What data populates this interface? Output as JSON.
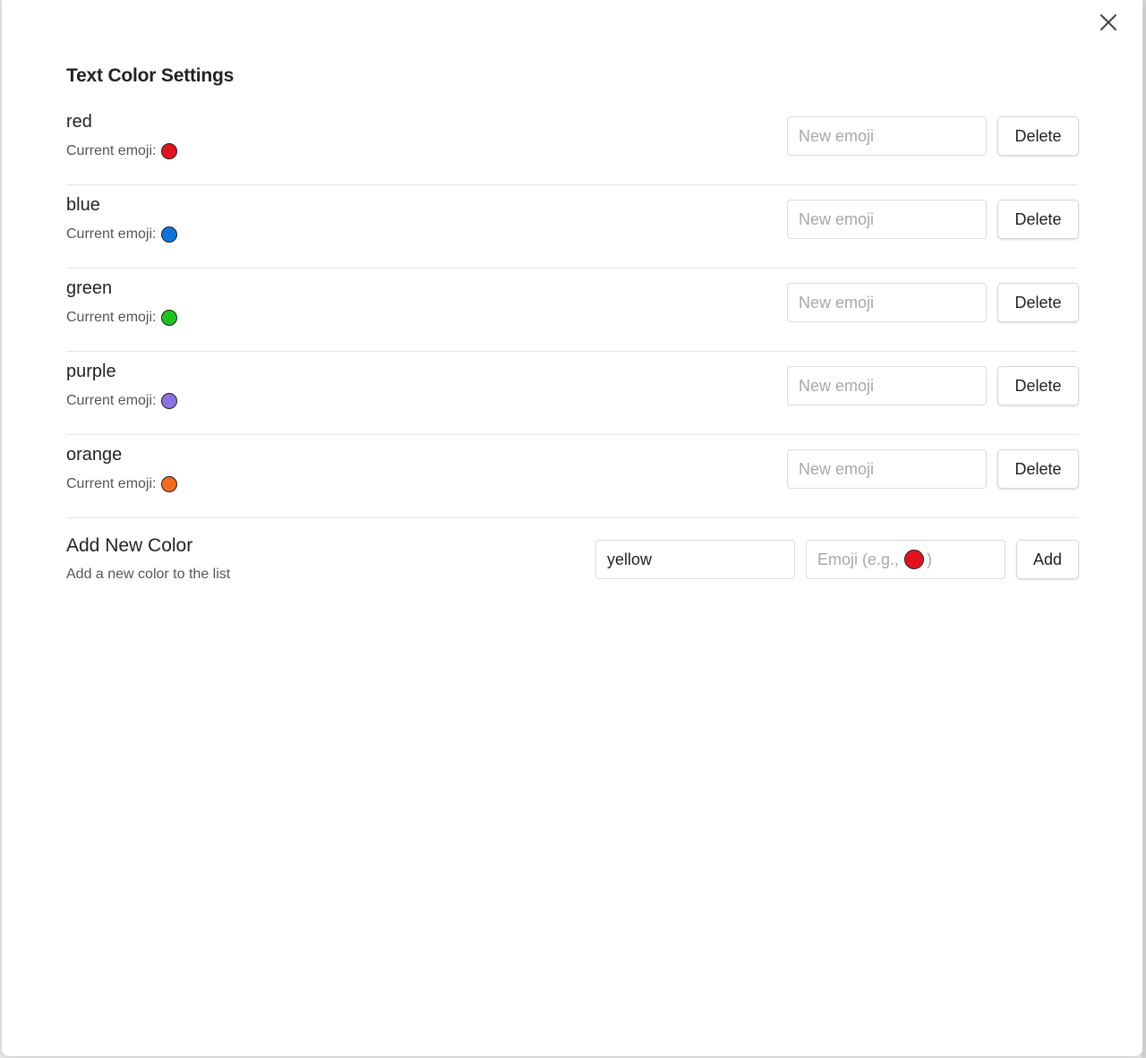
{
  "modal": {
    "title": "Text Color Settings",
    "close_icon": "close-icon"
  },
  "colors": [
    {
      "name": "red",
      "emoji_label": "Current emoji:",
      "emoji_color": "#e2131f",
      "input_placeholder": "New emoji",
      "delete_label": "Delete"
    },
    {
      "name": "blue",
      "emoji_label": "Current emoji:",
      "emoji_color": "#0a74dc",
      "input_placeholder": "New emoji",
      "delete_label": "Delete"
    },
    {
      "name": "green",
      "emoji_label": "Current emoji:",
      "emoji_color": "#1ec21e",
      "input_placeholder": "New emoji",
      "delete_label": "Delete"
    },
    {
      "name": "purple",
      "emoji_label": "Current emoji:",
      "emoji_color": "#8a72e0",
      "input_placeholder": "New emoji",
      "delete_label": "Delete"
    },
    {
      "name": "orange",
      "emoji_label": "Current emoji:",
      "emoji_color": "#f26b1d",
      "input_placeholder": "New emoji",
      "delete_label": "Delete"
    }
  ],
  "add_section": {
    "title": "Add New Color",
    "description": "Add a new color to the list",
    "name_value": "yellow",
    "emoji_placeholder_prefix": "Emoji (e.g.,",
    "emoji_placeholder_suffix": ")",
    "emoji_placeholder_color": "#e2131f",
    "add_label": "Add"
  }
}
